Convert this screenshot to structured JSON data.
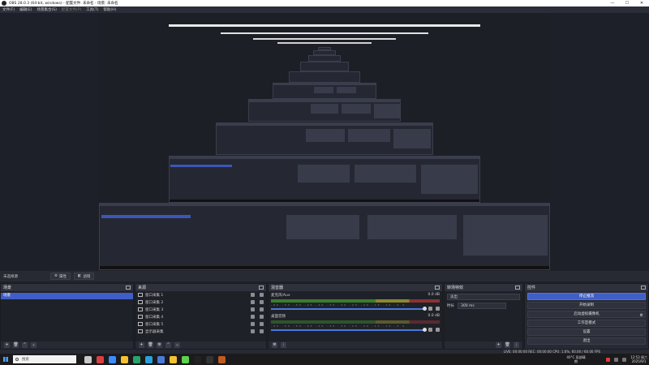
{
  "window": {
    "title": "OBS 28.0.3 (64-bit, windows) - 配置文件: 未命名 - 场景: 未命名",
    "controls": [
      "—",
      "☐",
      "✕"
    ]
  },
  "menu": [
    {
      "label": "文件(F)",
      "enabled": true
    },
    {
      "label": "编辑(E)",
      "enabled": true
    },
    {
      "label": "场景集合(S)",
      "enabled": true
    },
    {
      "label": "配置文件(P)",
      "enabled": false
    },
    {
      "label": "工具(T)",
      "enabled": true
    },
    {
      "label": "帮助(H)",
      "enabled": true
    }
  ],
  "modebar": {
    "label": "未选择源",
    "properties": "属性",
    "filters": "滤镜"
  },
  "scenes": {
    "title": "场景",
    "items": [
      "场景"
    ]
  },
  "sources": {
    "title": "来源",
    "items": [
      "窗口采集 1",
      "窗口采集 2",
      "窗口采集 3",
      "窗口采集 4",
      "窗口采集 5",
      "显示器采集"
    ]
  },
  "mixer": {
    "title": "混音器",
    "tracks": [
      {
        "name": "麦克风/Aux",
        "db": "0.0 dB"
      },
      {
        "name": "桌面音频",
        "db": "0.0 dB"
      }
    ],
    "ticks": "-60 -55 -50 -45 -40 -35 -30 -25 -20 -15 -10 -5 0"
  },
  "transitions": {
    "title": "转场特效",
    "type": "淡出",
    "duration_label": "时长",
    "duration": "300 ms"
  },
  "controls": {
    "title": "控件",
    "buttons": [
      "停止推流",
      "开始录制",
      "启动虚拟摄像机",
      "工作室模式",
      "设置",
      "退出"
    ]
  },
  "statusbar": {
    "text": "LIVE: 00:00:00   REC: 00:00:00   CPU: 1.6%, 60.00 / 60.00 FPS"
  },
  "taskbar": {
    "search_placeholder": "搜索",
    "weather": "40°C 局部晴朗",
    "time": "12:53 周六",
    "date": "2025/9/1",
    "icon_colors": [
      "#c9c9c9",
      "#d94040",
      "#3b8cff",
      "#f2c230",
      "#29a36a",
      "#2aa1d9",
      "#4b7bd9",
      "#f2c230",
      "#5bd34a",
      "#222222",
      "#333333",
      "#c05a20"
    ]
  },
  "colors": {
    "accent": "#3f5ec7",
    "panel": "#272a33",
    "background": "#1f2129"
  }
}
